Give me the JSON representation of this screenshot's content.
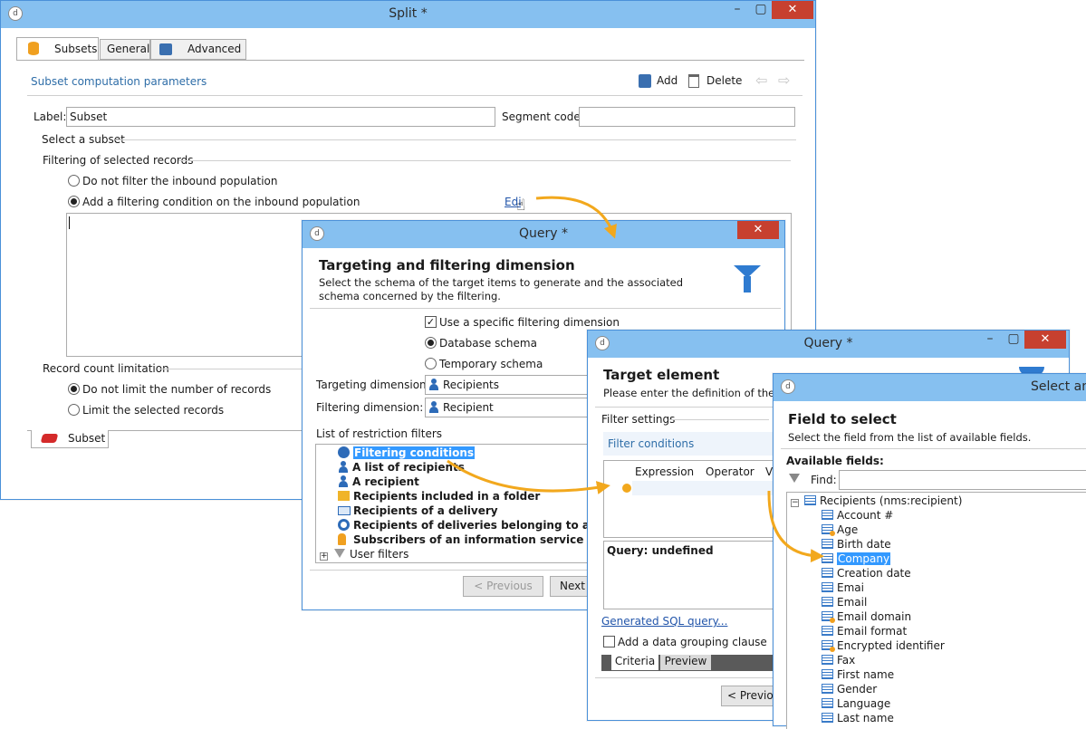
{
  "split_window": {
    "title": "Split *",
    "tabs": [
      "Subsets",
      "General",
      "Advanced"
    ],
    "section_title": "Subset computation parameters",
    "toolbar": {
      "add": "Add",
      "delete": "Delete"
    },
    "label_caption": "Label:",
    "label_value": "Subset",
    "segment_caption": "Segment code:",
    "segment_value": "",
    "select_subset": "Select a subset",
    "filtering_group": "Filtering of selected records",
    "radio_no_filter": "Do not filter the inbound population",
    "radio_add_filter": "Add a filtering condition on the inbound population",
    "edit_link": "Edit...",
    "record_count_group": "Record count limitation",
    "radio_no_limit": "Do not limit the number of records",
    "radio_limit": "Limit the selected records",
    "bottom_tab": "Subset"
  },
  "query_window_1": {
    "title": "Query *",
    "heading": "Targeting and filtering dimension",
    "description": "Select the schema of the target items to  generate and the associated schema concerned by the filtering.",
    "use_specific": "Use a specific filtering dimension",
    "database_schema": "Database schema",
    "temporary_schema": "Temporary schema",
    "targeting_caption": "Targeting dimension:",
    "targeting_value": "Recipients",
    "filtering_caption": "Filtering dimension:",
    "filtering_value": "Recipient",
    "restriction_caption": "List of restriction filters",
    "filters": [
      "Filtering conditions",
      "A list of recipients",
      "A recipient",
      "Recipients included in a folder",
      "Recipients of a delivery",
      "Recipients of deliveries belonging to a folder",
      "Subscribers of an information service",
      "User filters"
    ],
    "previous": "< Previous",
    "next": "Next"
  },
  "query_window_2": {
    "title": "Query *",
    "heading": "Target element",
    "description": "Please enter the definition of the tar",
    "filter_settings": "Filter settings",
    "filter_conditions": "Filter conditions",
    "col_expression": "Expression",
    "col_operator": "Operator",
    "col_value": "V",
    "query_text": "Query: undefined",
    "sql_link": "Generated SQL query...",
    "grouping": "Add a data grouping clause",
    "tabs": [
      "Criteria",
      "Preview"
    ],
    "previous": "< Previo"
  },
  "select_window": {
    "title": "Select an",
    "heading": "Field to select",
    "description": "Select the field from the list of available fields.",
    "available": "Available fields:",
    "find": "Find:",
    "root": "Recipients (nms:recipient)",
    "fields": [
      {
        "label": "Account #",
        "calc": false
      },
      {
        "label": "Age",
        "calc": true
      },
      {
        "label": "Birth date",
        "calc": false
      },
      {
        "label": "Company",
        "calc": false
      },
      {
        "label": "Creation date",
        "calc": false
      },
      {
        "label": "Emai",
        "calc": false
      },
      {
        "label": "Email",
        "calc": false
      },
      {
        "label": "Email domain",
        "calc": true
      },
      {
        "label": "Email format",
        "calc": false
      },
      {
        "label": "Encrypted identifier",
        "calc": true
      },
      {
        "label": "Fax",
        "calc": false
      },
      {
        "label": "First name",
        "calc": false
      },
      {
        "label": "Gender",
        "calc": false
      },
      {
        "label": "Language",
        "calc": false
      },
      {
        "label": "Last name",
        "calc": false
      }
    ]
  },
  "colors": {
    "titlebar": "#86c0f0",
    "window_border": "#4a90d9",
    "close_button": "#c7402f",
    "arrow": "#f2a81d",
    "selection": "#3399ff",
    "link": "#2255aa"
  }
}
